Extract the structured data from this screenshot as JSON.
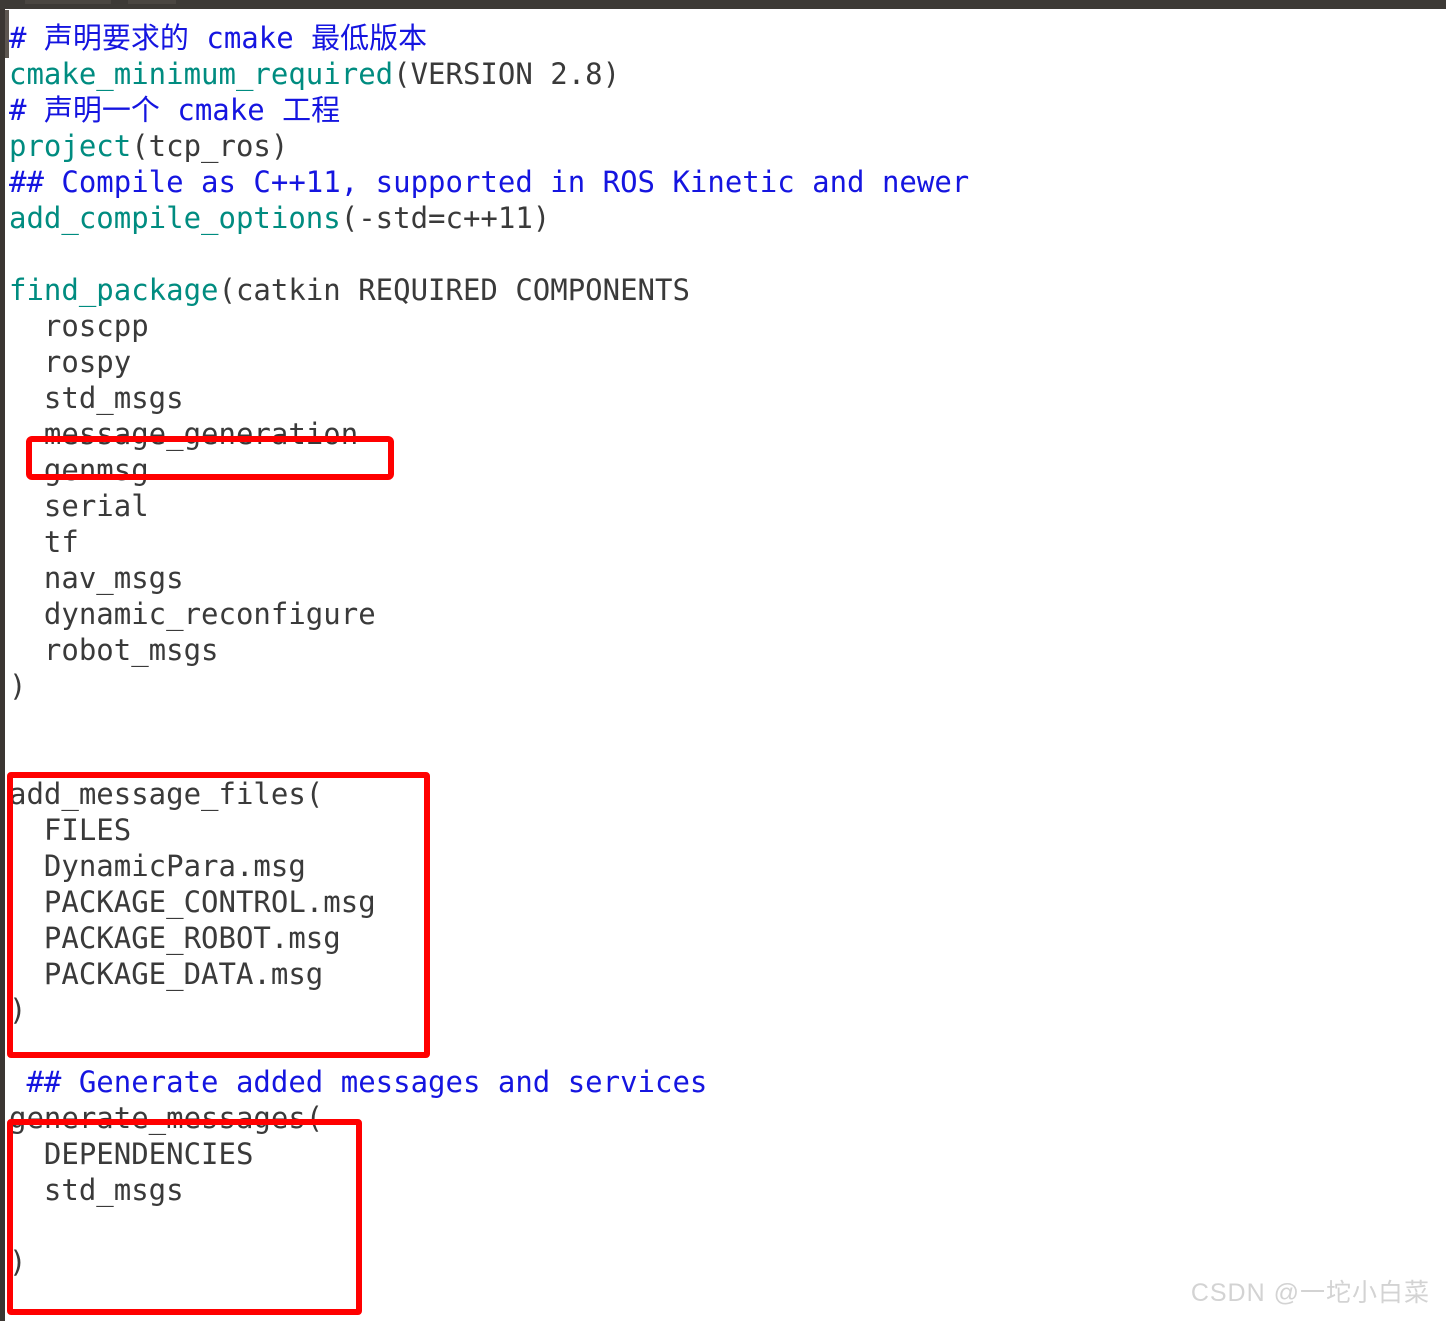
{
  "window": {
    "chrome": {
      "tabstrip_color": "#3d3a36",
      "tab_ghost_color": "#4a4641",
      "left_rail_color": "#3b3632"
    }
  },
  "editor": {
    "language": "cmake",
    "filename": "CMakeLists.txt",
    "background": "#ffffff",
    "colors": {
      "comment": "#1515e0",
      "function": "#008c80",
      "plain": "#3a3a3a",
      "annotation": "#ff0000"
    },
    "lines": [
      {
        "indent": 0,
        "tokens": [
          {
            "cls": "cmt",
            "text": "# 声明要求的 cmake 最低版本"
          }
        ]
      },
      {
        "indent": 0,
        "tokens": [
          {
            "cls": "fn",
            "text": "cmake_minimum_required"
          },
          {
            "cls": "pln",
            "text": "(VERSION 2.8)"
          }
        ]
      },
      {
        "indent": 0,
        "tokens": [
          {
            "cls": "cmt",
            "text": "# 声明一个 cmake 工程"
          }
        ]
      },
      {
        "indent": 0,
        "tokens": [
          {
            "cls": "fn",
            "text": "project"
          },
          {
            "cls": "pln",
            "text": "(tcp_ros)"
          }
        ]
      },
      {
        "indent": 0,
        "tokens": [
          {
            "cls": "cmt",
            "text": "## Compile as C++11, supported in ROS Kinetic and newer"
          }
        ]
      },
      {
        "indent": 0,
        "tokens": [
          {
            "cls": "fn",
            "text": "add_compile_options"
          },
          {
            "cls": "pln",
            "text": "(-std=c++11)"
          }
        ]
      },
      {
        "indent": 0,
        "tokens": [
          {
            "cls": "pln",
            "text": ""
          }
        ]
      },
      {
        "indent": 0,
        "tokens": [
          {
            "cls": "fn",
            "text": "find_package"
          },
          {
            "cls": "pln",
            "text": "(catkin REQUIRED COMPONENTS"
          }
        ]
      },
      {
        "indent": 0,
        "tokens": [
          {
            "cls": "pln",
            "text": "  roscpp"
          }
        ]
      },
      {
        "indent": 0,
        "tokens": [
          {
            "cls": "pln",
            "text": "  rospy"
          }
        ]
      },
      {
        "indent": 0,
        "tokens": [
          {
            "cls": "pln",
            "text": "  std_msgs"
          }
        ]
      },
      {
        "indent": 0,
        "tokens": [
          {
            "cls": "pln",
            "text": "  message_generation"
          }
        ]
      },
      {
        "indent": 0,
        "tokens": [
          {
            "cls": "pln",
            "text": "  genmsg"
          }
        ]
      },
      {
        "indent": 0,
        "tokens": [
          {
            "cls": "pln",
            "text": "  serial"
          }
        ]
      },
      {
        "indent": 0,
        "tokens": [
          {
            "cls": "pln",
            "text": "  tf"
          }
        ]
      },
      {
        "indent": 0,
        "tokens": [
          {
            "cls": "pln",
            "text": "  nav_msgs"
          }
        ]
      },
      {
        "indent": 0,
        "tokens": [
          {
            "cls": "pln",
            "text": "  dynamic_reconfigure"
          }
        ]
      },
      {
        "indent": 0,
        "tokens": [
          {
            "cls": "pln",
            "text": "  robot_msgs"
          }
        ]
      },
      {
        "indent": 0,
        "tokens": [
          {
            "cls": "pln",
            "text": ")"
          }
        ]
      },
      {
        "indent": 0,
        "tokens": [
          {
            "cls": "pln",
            "text": ""
          }
        ]
      },
      {
        "indent": 0,
        "tokens": [
          {
            "cls": "pln",
            "text": ""
          }
        ]
      },
      {
        "indent": 0,
        "tokens": [
          {
            "cls": "pln",
            "text": "add_message_files("
          }
        ]
      },
      {
        "indent": 0,
        "tokens": [
          {
            "cls": "pln",
            "text": "  FILES"
          }
        ]
      },
      {
        "indent": 0,
        "tokens": [
          {
            "cls": "pln",
            "text": "  DynamicPara.msg"
          }
        ]
      },
      {
        "indent": 0,
        "tokens": [
          {
            "cls": "pln",
            "text": "  PACKAGE_CONTROL.msg"
          }
        ]
      },
      {
        "indent": 0,
        "tokens": [
          {
            "cls": "pln",
            "text": "  PACKAGE_ROBOT.msg"
          }
        ]
      },
      {
        "indent": 0,
        "tokens": [
          {
            "cls": "pln",
            "text": "  PACKAGE_DATA.msg"
          }
        ]
      },
      {
        "indent": 0,
        "tokens": [
          {
            "cls": "pln",
            "text": ")"
          }
        ]
      },
      {
        "indent": 0,
        "tokens": [
          {
            "cls": "pln",
            "text": ""
          }
        ]
      },
      {
        "indent": 0,
        "tokens": [
          {
            "cls": "cmt",
            "text": " ## Generate added messages and services"
          }
        ]
      },
      {
        "indent": 0,
        "tokens": [
          {
            "cls": "pln",
            "text": "generate_messages("
          }
        ]
      },
      {
        "indent": 0,
        "tokens": [
          {
            "cls": "pln",
            "text": "  DEPENDENCIES"
          }
        ]
      },
      {
        "indent": 0,
        "tokens": [
          {
            "cls": "pln",
            "text": "  std_msgs"
          }
        ]
      },
      {
        "indent": 0,
        "tokens": [
          {
            "cls": "pln",
            "text": ""
          }
        ]
      },
      {
        "indent": 0,
        "tokens": [
          {
            "cls": "pln",
            "text": ")"
          }
        ]
      }
    ]
  },
  "annotations": [
    {
      "id": "box-message-generation",
      "label": "message_generation"
    },
    {
      "id": "box-add-message-files",
      "label": "add_message_files"
    },
    {
      "id": "box-generate-messages",
      "label": "generate_messages"
    }
  ],
  "watermark": {
    "text": "CSDN @一坨小白菜"
  }
}
